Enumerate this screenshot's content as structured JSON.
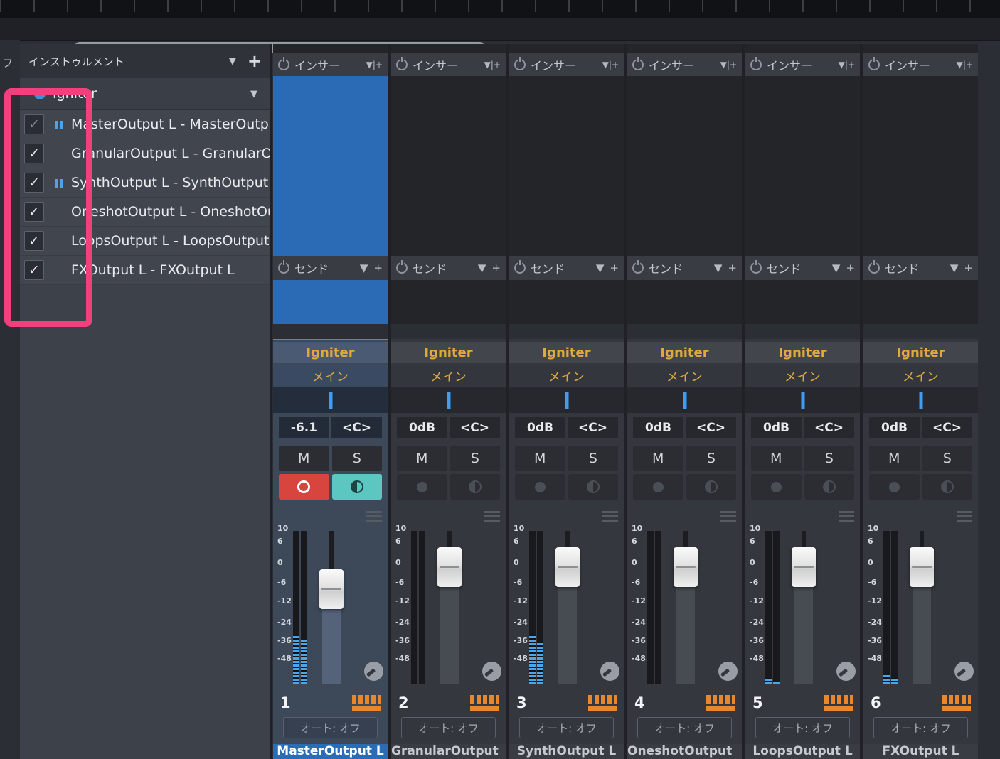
{
  "colors": {
    "selection_blue": "#2b6ab4",
    "meter_blue": "#4aa5ea",
    "label_gold": "#e0a93e",
    "record_red": "#d8453e",
    "monitor_teal": "#5cc6c0",
    "keyboard_orange": "#e8872b",
    "annotation_pink": "#f2407d"
  },
  "topbar": {
    "back_glyph": "◀"
  },
  "left_tab": {
    "fragment": "フ"
  },
  "panel": {
    "title": "インストゥルメント",
    "collapse_glyph": "▼",
    "add_glyph": "+",
    "check_glyph": "✓",
    "instrument": {
      "name": "Igniter",
      "collapse_glyph": "▼"
    },
    "outputs": [
      {
        "label": "MasterOutput L - MasterOutput L",
        "checked": true,
        "dimmed": true,
        "meter": true
      },
      {
        "label": "GranularOutput L - GranularOutput L",
        "checked": true,
        "dimmed": false,
        "meter": false
      },
      {
        "label": "SynthOutput L - SynthOutput L",
        "checked": true,
        "dimmed": false,
        "meter": true
      },
      {
        "label": "OneshotOutput L - OneshotOutput L",
        "checked": true,
        "dimmed": false,
        "meter": false
      },
      {
        "label": "LoopsOutput L - LoopsOutput L",
        "checked": true,
        "dimmed": false,
        "meter": false
      },
      {
        "label": "FXOutput L - FXOutput L",
        "checked": true,
        "dimmed": false,
        "meter": false
      }
    ]
  },
  "mixer": {
    "insert_label": "インサー",
    "insert_menu_glyph": "▼|+",
    "send_label": "センド",
    "send_collapse_glyph": "▼",
    "send_add_glyph": "+",
    "instrument_name": "Igniter",
    "bus_label": "メイン",
    "mute": "M",
    "solo": "S",
    "auto_label": "オート: オフ",
    "scale": [
      "10",
      "6",
      "0",
      "-6",
      "-12",
      "-24",
      "-36",
      "-48"
    ],
    "strips": [
      {
        "number": "1",
        "volume": "-6.1",
        "pan": "<C>",
        "name": "MasterOutput L",
        "selected": true,
        "armed": true,
        "monitored": true,
        "volume_db": -6.1,
        "meter_l": 0.32,
        "meter_r": 0.29
      },
      {
        "number": "2",
        "volume": "0dB",
        "pan": "<C>",
        "name": "GranularOutput L",
        "selected": false,
        "armed": false,
        "monitored": false,
        "volume_db": 0,
        "meter_l": 0,
        "meter_r": 0
      },
      {
        "number": "3",
        "volume": "0dB",
        "pan": "<C>",
        "name": "SynthOutput L",
        "selected": false,
        "armed": false,
        "monitored": false,
        "volume_db": 0,
        "meter_l": 0.32,
        "meter_r": 0.28
      },
      {
        "number": "4",
        "volume": "0dB",
        "pan": "<C>",
        "name": "OneshotOutput L",
        "selected": false,
        "armed": false,
        "monitored": false,
        "volume_db": 0,
        "meter_l": 0,
        "meter_r": 0
      },
      {
        "number": "5",
        "volume": "0dB",
        "pan": "<C>",
        "name": "LoopsOutput L",
        "selected": false,
        "armed": false,
        "monitored": false,
        "volume_db": 0,
        "meter_l": 0.04,
        "meter_r": 0.02
      },
      {
        "number": "6",
        "volume": "0dB",
        "pan": "<C>",
        "name": "FXOutput L",
        "selected": false,
        "armed": false,
        "monitored": false,
        "volume_db": 0,
        "meter_l": 0.06,
        "meter_r": 0.04
      }
    ]
  }
}
